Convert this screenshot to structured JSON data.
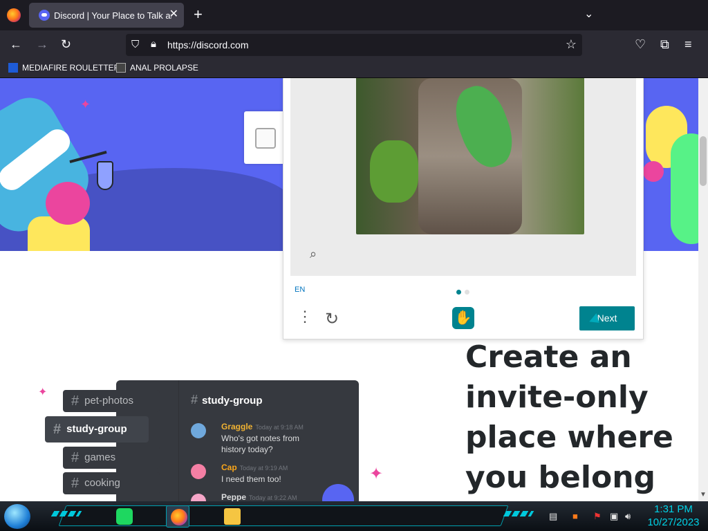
{
  "browser": {
    "tab": {
      "title": "Discord | Your Place to Talk and",
      "close": "✕"
    },
    "new_tab": "+",
    "tab_list": "⌄",
    "url": "https://discord.com",
    "bookmarks": [
      {
        "label": "MEDIAFIRE ROULETTER",
        "icon": "mediafire-icon"
      },
      {
        "label": "ANAL PROLAPSE",
        "icon": "terminal-icon"
      }
    ]
  },
  "captcha": {
    "language": "EN",
    "next_label": "Next",
    "search_icon": "search-icon",
    "refresh_icon": "refresh-icon",
    "page_dots": 2,
    "active_dot": 1
  },
  "page": {
    "headline": "Create an invite-only place where you belong",
    "channels": [
      {
        "label": "pet-photos"
      },
      {
        "label": "study-group",
        "active": true
      },
      {
        "label": "games"
      },
      {
        "label": "cooking"
      }
    ],
    "chat": {
      "channel": "study-group",
      "messages": [
        {
          "name": "Graggle",
          "time": "Today at 9:18 AM",
          "text": "Who's got notes from history today?",
          "color": "#f0b232"
        },
        {
          "name": "Cap",
          "time": "Today at 9:19 AM",
          "text": "I need them too!",
          "color": "#faa61a"
        },
        {
          "name": "Peppe",
          "time": "Today at 9:22 AM",
          "text": "",
          "color": "#dcddde"
        }
      ]
    }
  },
  "taskbar": {
    "time": "1:31 PM",
    "date": "10/27/2023"
  },
  "colors": {
    "blurple": "#5865f2",
    "captcha_accent": "#00838f",
    "dark_text": "#23272a"
  }
}
